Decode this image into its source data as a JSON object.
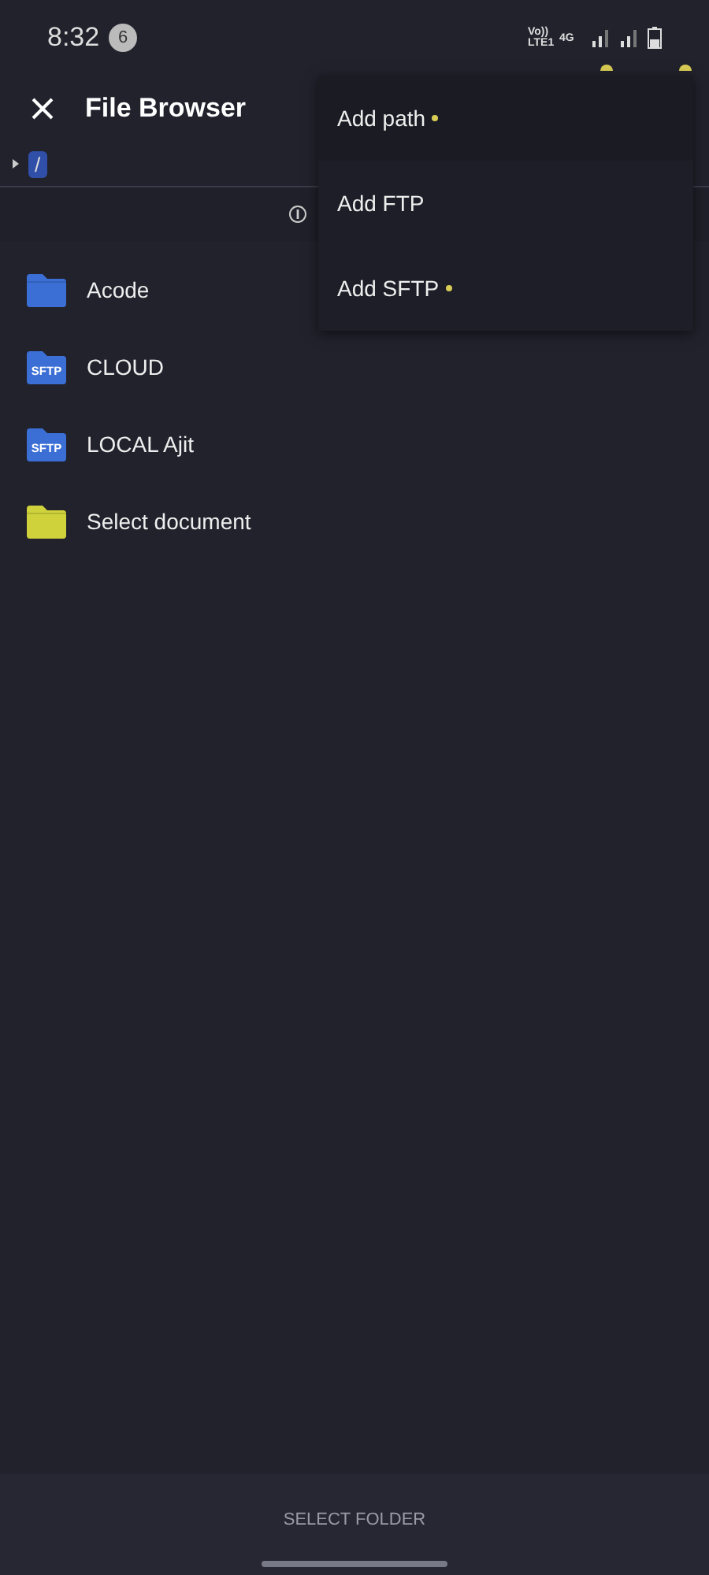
{
  "status_bar": {
    "time": "8:32",
    "notification_count": "6",
    "network_label": "Vo)) LTE1",
    "data_label": "4G"
  },
  "app_bar": {
    "title": "File Browser"
  },
  "breadcrumb": [
    {
      "label": "/",
      "selected": true
    }
  ],
  "files": [
    {
      "name": "Acode",
      "kind": "folder",
      "color": "#3b6fd6"
    },
    {
      "name": "CLOUD",
      "kind": "sftp",
      "color": "#3b6fd6",
      "badge": "SFTP"
    },
    {
      "name": "LOCAL Ajit",
      "kind": "sftp",
      "color": "#3b6fd6",
      "badge": "SFTP"
    },
    {
      "name": "Select document",
      "kind": "folder",
      "color": "#cfd23a"
    }
  ],
  "menu": [
    {
      "label": "Add path",
      "new": true
    },
    {
      "label": "Add FTP",
      "new": false
    },
    {
      "label": "Add SFTP",
      "new": true
    }
  ],
  "footer": {
    "button": "SELECT FOLDER"
  }
}
